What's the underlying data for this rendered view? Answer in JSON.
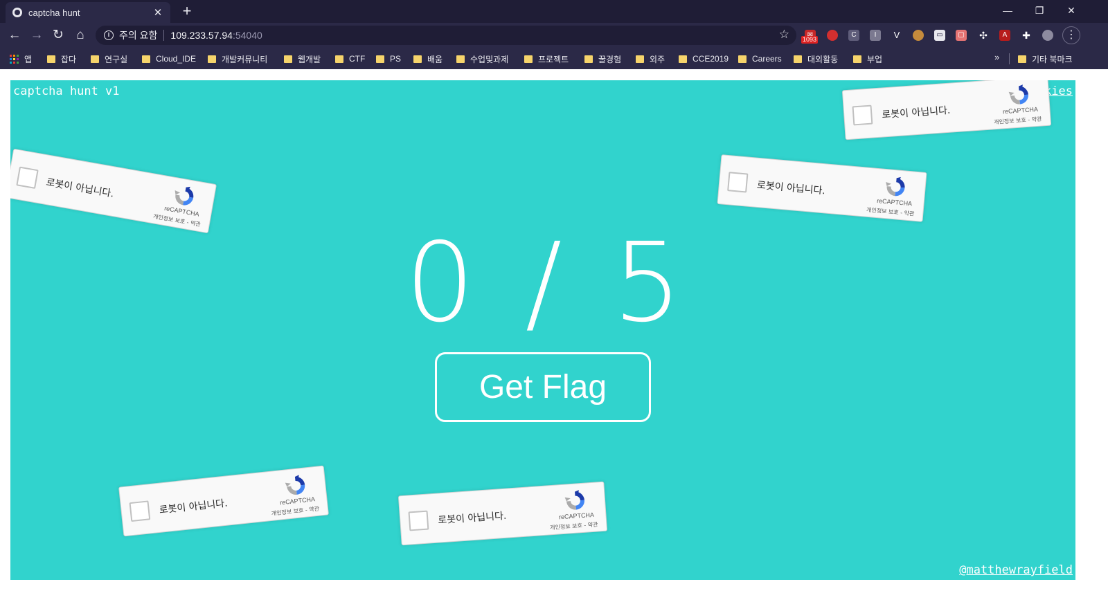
{
  "browser": {
    "tab_title": "captcha hunt",
    "tab_close": "✕",
    "new_tab": "+",
    "minimize": "—",
    "restore": "❐",
    "close": "✕",
    "back": "←",
    "forward": "→",
    "reload": "↻",
    "home": "⌂",
    "security_label": "주의 요함",
    "url_host": "109.233.57.94",
    "url_port": ":54040",
    "star": "☆",
    "ext_badge": "1093",
    "menu": "⋮"
  },
  "bookmarks": {
    "apps_label": "앱",
    "folders": [
      "잡다",
      "연구실",
      "Cloud_IDE",
      "개발커뮤니티",
      "웹개발",
      "CTF",
      "PS",
      "배움",
      "수업및과제",
      "프로젝트",
      "꿀경험",
      "외주",
      "CCE2019",
      "Careers",
      "대외활동",
      "부업"
    ],
    "more": "»",
    "other_label": "기타 북마크"
  },
  "page": {
    "app_title": "captcha hunt v1",
    "cookies_link": "cookies",
    "author_link": "@matthewrayfield",
    "counter": {
      "found": "0",
      "slash": "/",
      "total": "5"
    },
    "get_flag_label": "Get Flag",
    "accent_color": "#31d3cd"
  },
  "captcha": {
    "label": "로봇이 아닙니다.",
    "brand": "reCAPTCHA",
    "terms": "개인정보 보호 - 약관",
    "icon": "recaptcha-icon"
  }
}
